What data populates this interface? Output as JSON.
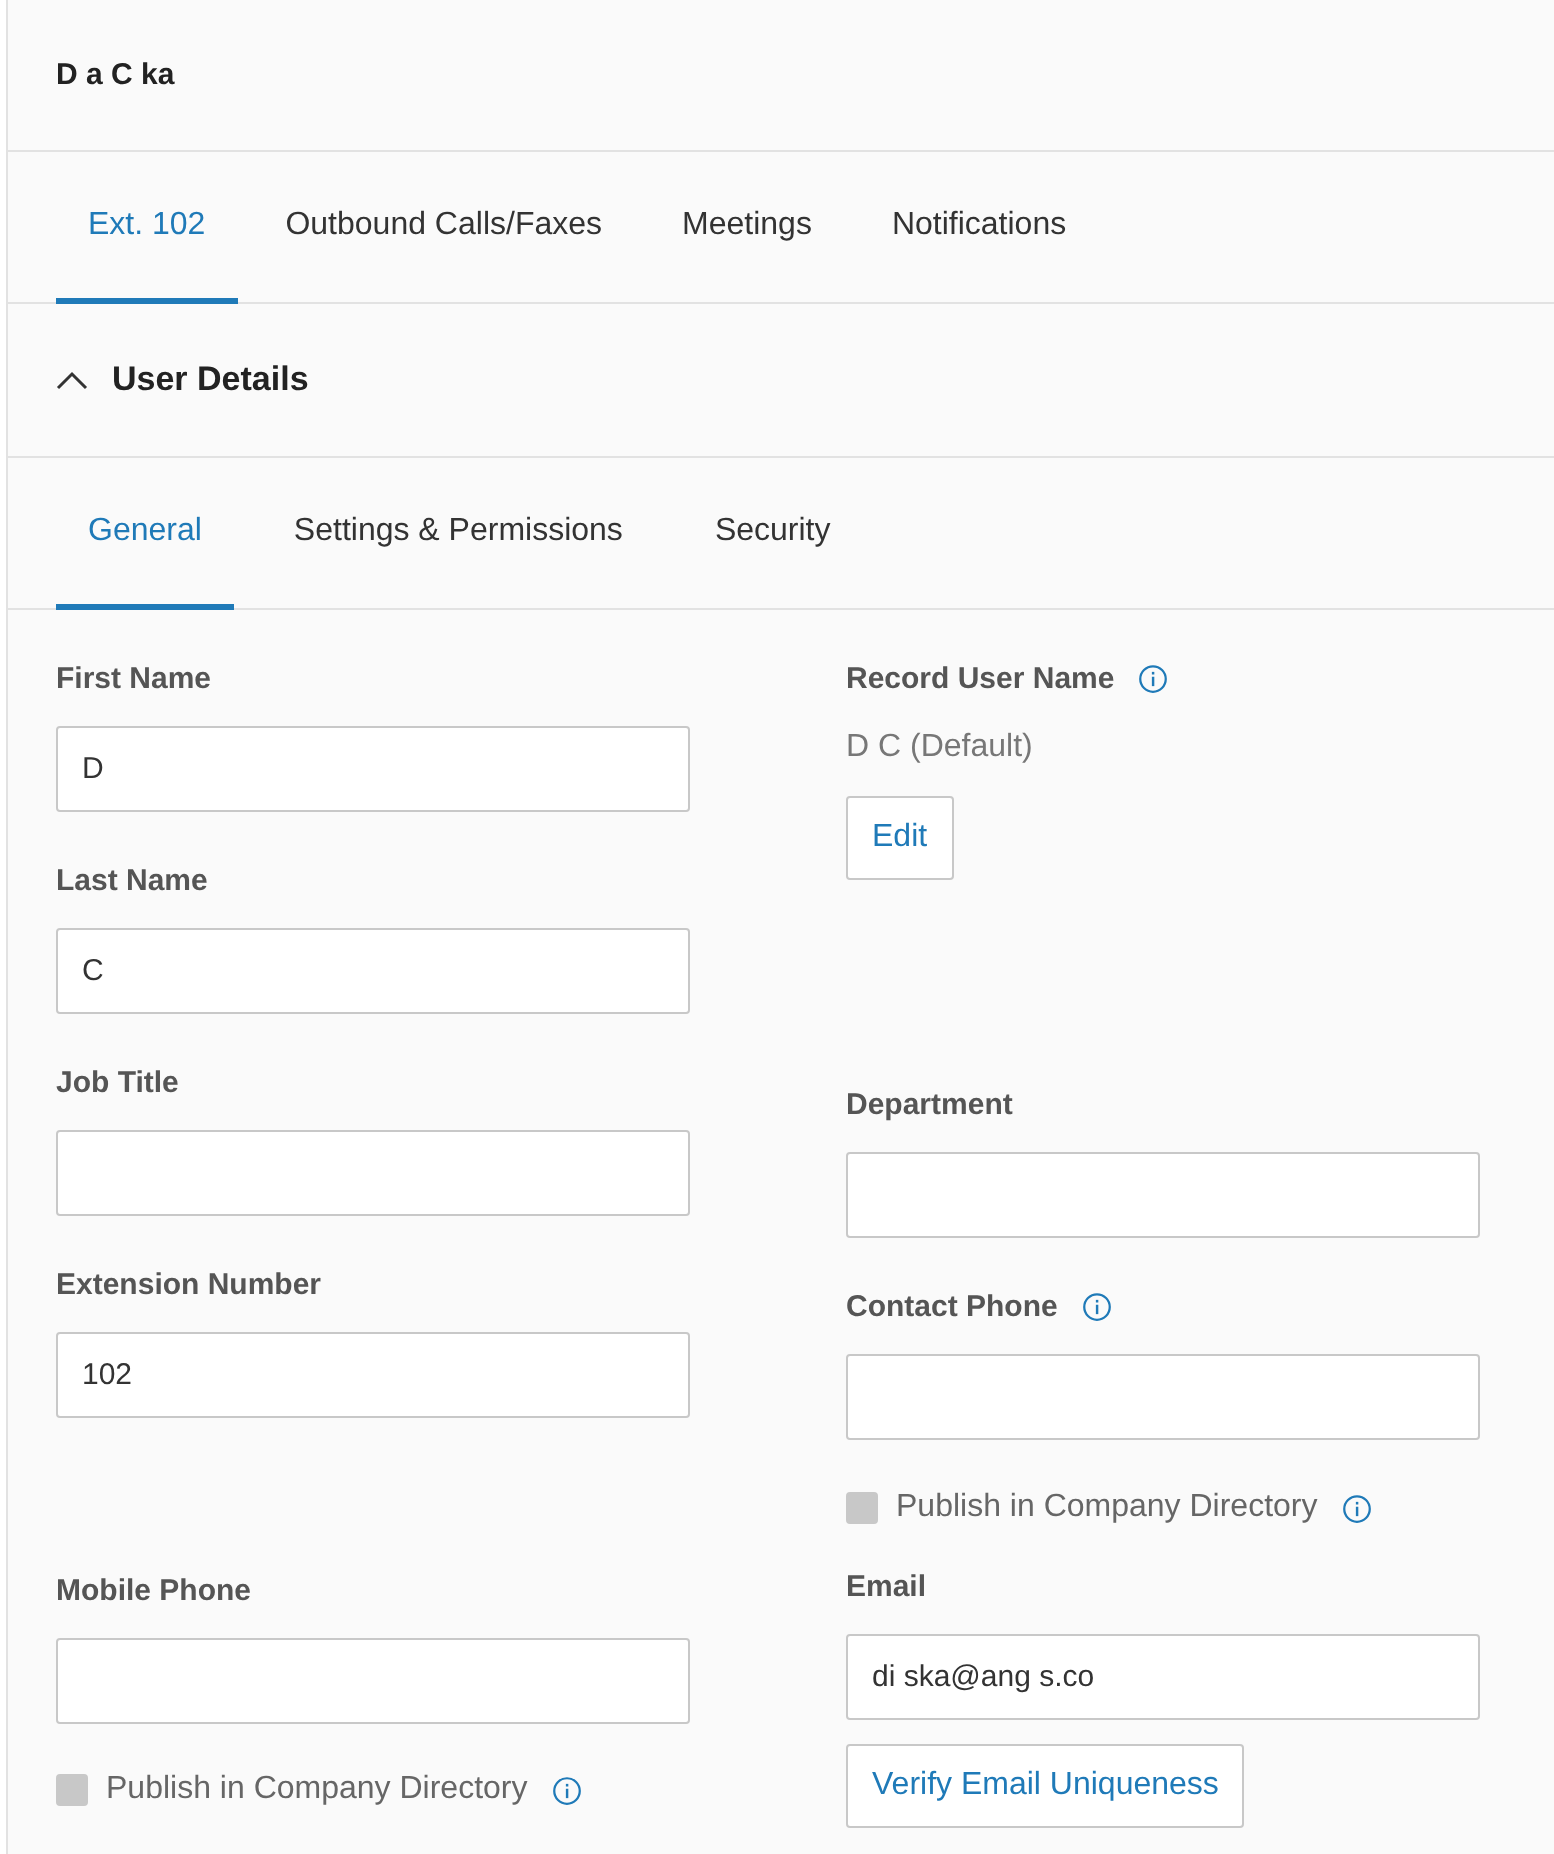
{
  "header": {
    "title": "D a C ka"
  },
  "tabs": [
    {
      "label": "Ext. 102",
      "selected": true
    },
    {
      "label": "Outbound Calls/Faxes",
      "selected": false
    },
    {
      "label": "Meetings",
      "selected": false
    },
    {
      "label": "Notifications",
      "selected": false
    }
  ],
  "section": {
    "title": "User Details",
    "expanded": true
  },
  "subtabs": [
    {
      "label": "General",
      "selected": true
    },
    {
      "label": "Settings & Permissions",
      "selected": false
    },
    {
      "label": "Security",
      "selected": false
    }
  ],
  "left": [
    {
      "kind": "field",
      "label": "First Name",
      "value": "D"
    },
    {
      "kind": "field",
      "label": "Last Name",
      "value": "C"
    },
    {
      "kind": "field",
      "label": "Job Title"
    },
    {
      "kind": "field",
      "label": "Extension Number",
      "value": "102"
    },
    {
      "kind": "field",
      "label": "Mobile Phone"
    },
    {
      "kind": "checkbox",
      "label": "Publish in Company Directory",
      "checked": false,
      "disabled": true,
      "info": true
    }
  ],
  "right": [
    {
      "kind": "record",
      "label": "Record User Name",
      "info": true,
      "value": "D C (Default)",
      "button": "Edit"
    },
    {
      "kind": "field",
      "label": "Department"
    },
    {
      "kind": "field",
      "label": "Contact Phone",
      "info": true
    },
    {
      "kind": "checkbox",
      "label": "Publish in Company Directory",
      "checked": false,
      "disabled": true,
      "info": true
    },
    {
      "kind": "field",
      "label": "Email",
      "value": "di ska@ang s.co"
    },
    {
      "kind": "button",
      "label": "Verify Email Uniqueness"
    }
  ]
}
